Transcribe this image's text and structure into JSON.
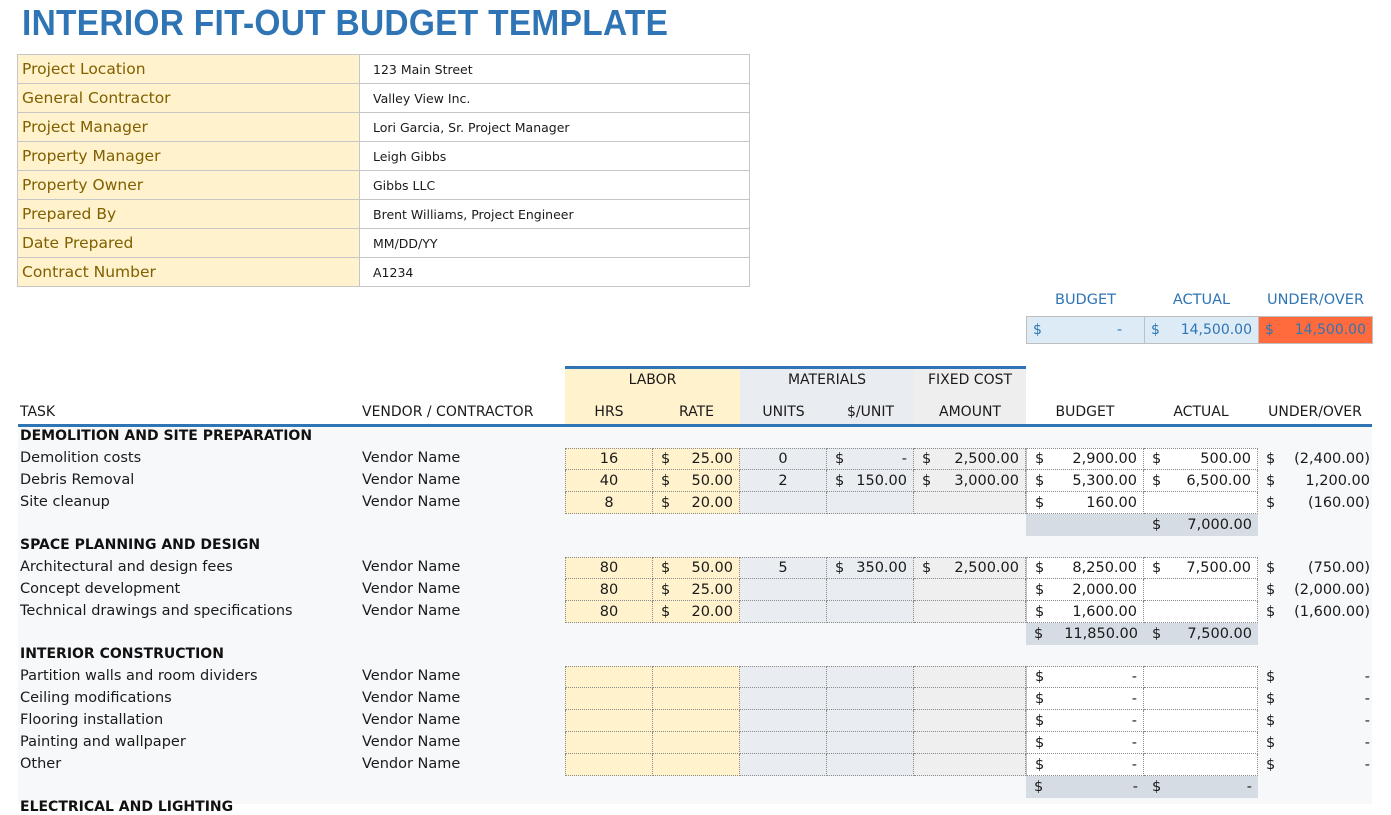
{
  "title": "INTERIOR FIT-OUT BUDGET TEMPLATE",
  "project_info": [
    {
      "label": "Project Location",
      "value": "123 Main Street"
    },
    {
      "label": "General Contractor",
      "value": "Valley View Inc."
    },
    {
      "label": "Project Manager",
      "value": "Lori Garcia, Sr. Project Manager"
    },
    {
      "label": "Property Manager",
      "value": "Leigh Gibbs"
    },
    {
      "label": "Property Owner",
      "value": "Gibbs LLC"
    },
    {
      "label": "Prepared By",
      "value": "Brent Williams, Project Engineer"
    },
    {
      "label": "Date Prepared",
      "value": "MM/DD/YY"
    },
    {
      "label": "Contract Number",
      "value": "A1234"
    }
  ],
  "summary": {
    "budget_label": "BUDGET",
    "actual_label": "ACTUAL",
    "under_over_label": "UNDER/OVER",
    "currency": "$",
    "budget": "-",
    "actual": "14,500.00",
    "under_over": "14,500.00",
    "under_over_color": "#ff6b3d"
  },
  "headers": {
    "task": "TASK",
    "vendor": "VENDOR / CONTRACTOR",
    "labor": "LABOR",
    "materials": "MATERIALS",
    "fixed_cost": "FIXED COST",
    "hrs": "HRS",
    "rate": "RATE",
    "units": "UNITS",
    "per_unit": "$/UNIT",
    "amount": "AMOUNT",
    "budget": "BUDGET",
    "actual": "ACTUAL",
    "under_over": "UNDER/OVER"
  },
  "currency": "$",
  "sections": [
    {
      "name": "DEMOLITION AND SITE PREPARATION",
      "rows": [
        {
          "task": "Demolition costs",
          "vendor": "Vendor Name",
          "hrs": "16",
          "rate": "25.00",
          "units": "0",
          "per_unit": "-",
          "amount": "2,500.00",
          "budget": "2,900.00",
          "actual": "500.00",
          "under_over": "(2,400.00)"
        },
        {
          "task": "Debris Removal",
          "vendor": "Vendor Name",
          "hrs": "40",
          "rate": "50.00",
          "units": "2",
          "per_unit": "150.00",
          "amount": "3,000.00",
          "budget": "5,300.00",
          "actual": "6,500.00",
          "under_over": "1,200.00"
        },
        {
          "task": "Site cleanup",
          "vendor": "Vendor Name",
          "hrs": "8",
          "rate": "20.00",
          "units": "",
          "per_unit": "",
          "amount": "",
          "budget": "160.00",
          "actual": "",
          "under_over": "(160.00)"
        }
      ],
      "subtotal": {
        "budget": "",
        "actual": "7,000.00"
      }
    },
    {
      "name": "SPACE PLANNING AND DESIGN",
      "rows": [
        {
          "task": "Architectural and design fees",
          "vendor": "Vendor Name",
          "hrs": "80",
          "rate": "50.00",
          "units": "5",
          "per_unit": "350.00",
          "amount": "2,500.00",
          "budget": "8,250.00",
          "actual": "7,500.00",
          "under_over": "(750.00)"
        },
        {
          "task": "Concept development",
          "vendor": "Vendor Name",
          "hrs": "80",
          "rate": "25.00",
          "units": "",
          "per_unit": "",
          "amount": "",
          "budget": "2,000.00",
          "actual": "",
          "under_over": "(2,000.00)"
        },
        {
          "task": "Technical drawings and specifications",
          "vendor": "Vendor Name",
          "hrs": "80",
          "rate": "20.00",
          "units": "",
          "per_unit": "",
          "amount": "",
          "budget": "1,600.00",
          "actual": "",
          "under_over": "(1,600.00)"
        }
      ],
      "subtotal": {
        "budget": "11,850.00",
        "actual": "7,500.00"
      }
    },
    {
      "name": "INTERIOR CONSTRUCTION",
      "rows": [
        {
          "task": "Partition walls and room dividers",
          "vendor": "Vendor Name",
          "hrs": "",
          "rate": "",
          "units": "",
          "per_unit": "",
          "amount": "",
          "budget": "-",
          "actual": "",
          "under_over": "-"
        },
        {
          "task": "Ceiling modifications",
          "vendor": "Vendor Name",
          "hrs": "",
          "rate": "",
          "units": "",
          "per_unit": "",
          "amount": "",
          "budget": "-",
          "actual": "",
          "under_over": "-"
        },
        {
          "task": "Flooring installation",
          "vendor": "Vendor Name",
          "hrs": "",
          "rate": "",
          "units": "",
          "per_unit": "",
          "amount": "",
          "budget": "-",
          "actual": "",
          "under_over": "-"
        },
        {
          "task": "Painting and wallpaper",
          "vendor": "Vendor Name",
          "hrs": "",
          "rate": "",
          "units": "",
          "per_unit": "",
          "amount": "",
          "budget": "-",
          "actual": "",
          "under_over": "-"
        },
        {
          "task": "Other",
          "vendor": "Vendor Name",
          "hrs": "",
          "rate": "",
          "units": "",
          "per_unit": "",
          "amount": "",
          "budget": "-",
          "actual": "",
          "under_over": "-"
        }
      ],
      "subtotal": {
        "budget": "-",
        "actual": "-"
      }
    },
    {
      "name": "ELECTRICAL AND LIGHTING",
      "rows": [],
      "subtotal": null
    }
  ]
}
